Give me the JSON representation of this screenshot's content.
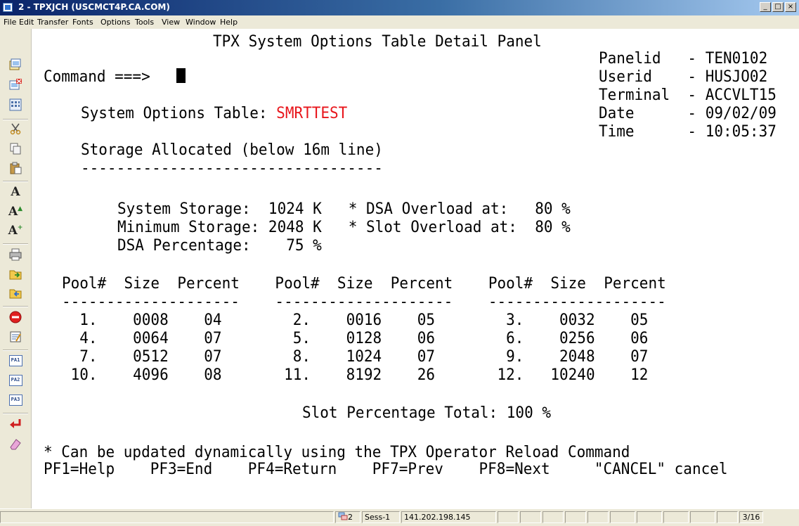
{
  "window": {
    "title": "2 - TPXJCH (USCMCT4P.CA.COM)"
  },
  "window_buttons": {
    "minimize": "_",
    "maximize": "□",
    "close": "×"
  },
  "menu": [
    "File",
    "Edit",
    "Transfer",
    "Fonts",
    "Options",
    "Tools",
    "View",
    "Window",
    "Help"
  ],
  "toolbar_icons": [
    "new-session-icon",
    "disconnect-icon",
    "keypad-icon",
    "cut-icon",
    "copy-icon",
    "paste-icon",
    "font-icon",
    "font-bigger-icon",
    "font-smaller-icon",
    "print-icon",
    "send-file-icon",
    "receive-file-icon",
    "stop-icon",
    "properties-icon",
    "pa1-key-icon",
    "pa2-key-icon",
    "pa3-key-icon",
    "enter-key-icon",
    "erase-icon"
  ],
  "toolbar_text": {
    "font": "A",
    "font_bigger": "A",
    "font_smaller": "A",
    "pa1": "PA1",
    "pa2": "PA2",
    "pa3": "PA3"
  },
  "panel": {
    "title": "TPX System Options Table Detail Panel",
    "command_label": "Command ===>",
    "info": {
      "panelid": "Panelid   - TEN0102",
      "userid": "Userid    - HUSJO02",
      "terminal": "Terminal  - ACCVLT15",
      "date": "Date      - 09/02/09",
      "time": "Time      - 10:05:37"
    },
    "system_options_label": "System Options Table:",
    "system_options_value": "SMRTTEST",
    "storage_heading": "Storage Allocated (below 16m line)",
    "storage_rule": "----------------------------------",
    "storage_lines": [
      "System Storage:  1024 K   * DSA Overload at:   80 %",
      "Minimum Storage: 2048 K   * Slot Overload at:  80 %",
      "DSA Percentage:    75 %"
    ],
    "pool_header": "Pool#  Size  Percent    Pool#  Size  Percent    Pool#  Size  Percent",
    "pool_rule": "--------------------    --------------------    --------------------",
    "pool_rows": [
      "  1.    0008    04        2.    0016    05        3.    0032    05",
      "  4.    0064    07        5.    0128    06        6.    0256    06",
      "  7.    0512    07        8.    1024    07        9.    2048    07",
      " 10.    4096    08       11.    8192    26       12.   10240    12"
    ],
    "slot_total": "Slot Percentage Total: 100 %",
    "footnote": "* Can be updated dynamically using the TPX Operator Reload Command",
    "pfkeys": "PF1=Help    PF3=End    PF4=Return    PF7=Prev    PF8=Next     \"CANCEL\" cancel"
  },
  "status": {
    "session_num": "2",
    "session_name": "Sess-1",
    "ip": "141.202.198.145",
    "page": "3/16"
  }
}
